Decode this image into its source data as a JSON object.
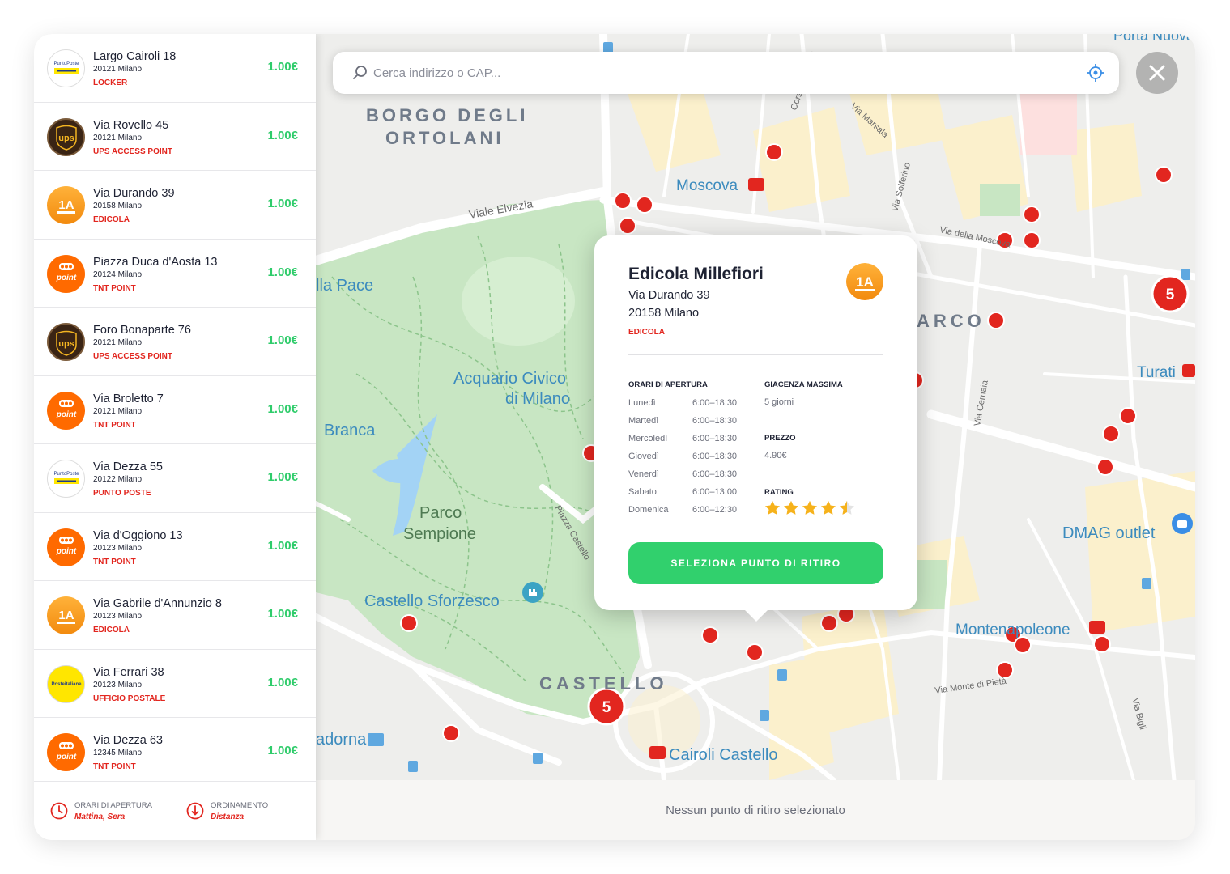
{
  "search": {
    "placeholder": "Cerca indirizzo o CAP..."
  },
  "list": [
    {
      "title": "Largo Cairoli 18",
      "city": "20121 Milano",
      "type": "LOCKER",
      "price": "1.00€",
      "logo": "poste-white",
      "logo_text": "PuntoPoste"
    },
    {
      "title": "Via Rovello 45",
      "city": "20121 Milano",
      "type": "UPS ACCESS POINT",
      "price": "1.00€",
      "logo": "ups",
      "logo_text": "ups"
    },
    {
      "title": "Via Durando 39",
      "city": "20158 Milano",
      "type": "EDICOLA",
      "price": "1.00€",
      "logo": "1a",
      "logo_text": "1A"
    },
    {
      "title": "Piazza Duca d'Aosta 13",
      "city": "20124 Milano",
      "type": "TNT POINT",
      "price": "1.00€",
      "logo": "tnt",
      "logo_text": "point"
    },
    {
      "title": "Foro Bonaparte 76",
      "city": "20121 Milano",
      "type": "UPS ACCESS POINT",
      "price": "1.00€",
      "logo": "ups",
      "logo_text": "ups"
    },
    {
      "title": "Via Broletto 7",
      "city": "20121 Milano",
      "type": "TNT POINT",
      "price": "1.00€",
      "logo": "tnt",
      "logo_text": "point"
    },
    {
      "title": "Via Dezza 55",
      "city": "20122 Milano",
      "type": "PUNTO POSTE",
      "price": "1.00€",
      "logo": "poste-white",
      "logo_text": "PuntoPoste"
    },
    {
      "title": "Via d'Oggiono 13",
      "city": "20123 Milano",
      "type": "TNT POINT",
      "price": "1.00€",
      "logo": "tnt",
      "logo_text": "point"
    },
    {
      "title": "Via Gabrile d'Annunzio 8",
      "city": "20123 Milano",
      "type": "EDICOLA",
      "price": "1.00€",
      "logo": "1a",
      "logo_text": "1A"
    },
    {
      "title": "Via Ferrari 38",
      "city": "20123 Milano",
      "type": "UFFICIO POSTALE",
      "price": "1.00€",
      "logo": "poste-yellow",
      "logo_text": "Posteitaliane"
    },
    {
      "title": "Via Dezza 63",
      "city": "12345 Milano",
      "type": "TNT POINT",
      "price": "1.00€",
      "logo": "tnt",
      "logo_text": "point"
    }
  ],
  "footer": {
    "hours_label": "ORARI DI APERTURA",
    "hours_value": "Mattina, Sera",
    "sort_label": "ORDINAMENTO",
    "sort_value": "Distanza"
  },
  "popup": {
    "name": "Edicola Millefiori",
    "address": "Via Durando 39",
    "city": "20158 Milano",
    "type": "EDICOLA",
    "logo_text": "1A",
    "hours_title": "ORARI DI APERTURA",
    "hours": [
      {
        "day": "Lunedì",
        "time": "6:00–18:30"
      },
      {
        "day": "Martedì",
        "time": "6:00–18:30"
      },
      {
        "day": "Mercoledì",
        "time": "6:00–18:30"
      },
      {
        "day": "Giovedì",
        "time": "6:00–18:30"
      },
      {
        "day": "Venerdì",
        "time": "6:00–18:30"
      },
      {
        "day": "Sabato",
        "time": "6:00–13:00"
      },
      {
        "day": "Domenica",
        "time": "6:00–12:30"
      }
    ],
    "storage_title": "GIACENZA MASSIMA",
    "storage_value": "5 giorni",
    "price_title": "PREZZO",
    "price_value": "4.90€",
    "rating_title": "RATING",
    "rating": 4.5,
    "button": "SELEZIONA PUNTO DI RITIRO"
  },
  "map": {
    "labels": [
      "BORGO DEGLI",
      "ORTOLANI",
      "Moscova",
      "Viale Elvezia",
      "Via Marsala",
      "Via Solferino",
      "Via della Moscova",
      "lla Pace",
      "Acquario Civico",
      "di Milano",
      "Branca",
      "Parco",
      "Sempione",
      "Castello Sforzesco",
      "CASTELLO",
      "Piazza Castello",
      "Cairoli Castello",
      "adorna",
      "ARCO",
      "Via Cernaia",
      "Turati",
      "DMAG outlet",
      "Montenapoleone",
      "Via Monte di Pietà",
      "Via Bigli",
      "Corso Garibaldi",
      "Porta Nuova"
    ],
    "cluster_count": "5"
  },
  "bottom_status": "Nessun punto di ritiro selezionato",
  "colors": {
    "accent_red": "#e2261f",
    "accent_green": "#31d06d",
    "park": "#c8e6c3"
  }
}
